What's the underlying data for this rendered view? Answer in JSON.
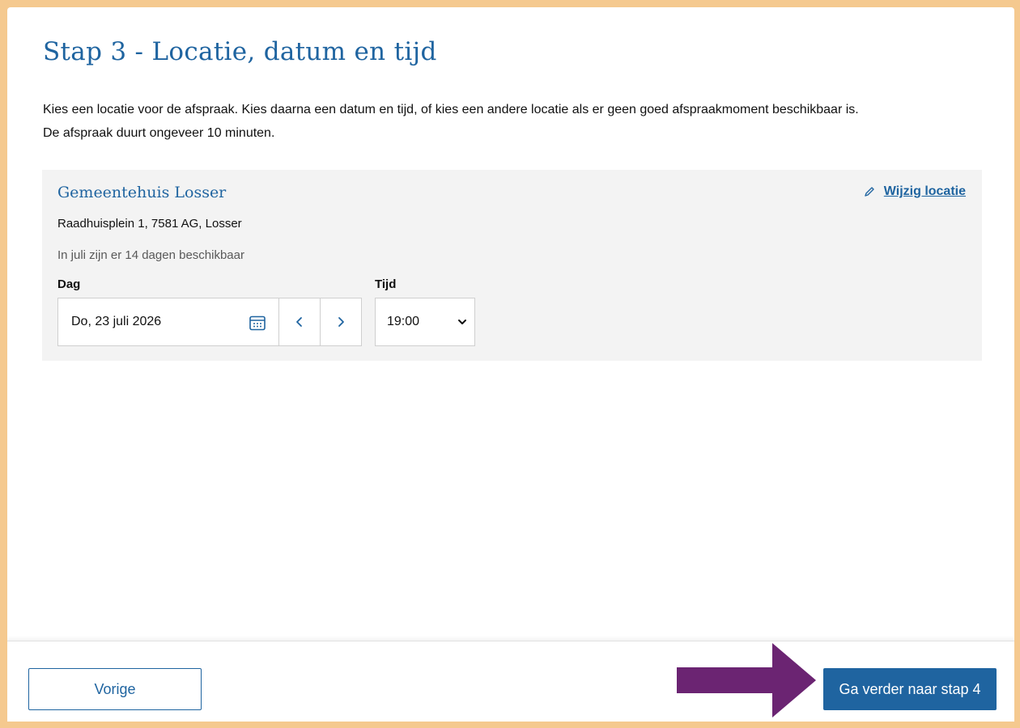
{
  "step": {
    "title": "Stap 3 - Locatie, datum en tijd",
    "intro_line1": "Kies een locatie voor de afspraak. Kies daarna een datum en tijd, of kies een andere locatie als er geen goed afspraakmoment beschikbaar is.",
    "intro_line2": "De afspraak duurt ongeveer 10 minuten."
  },
  "location": {
    "name": "Gemeentehuis Losser",
    "change_label": "Wijzig locatie",
    "address": "Raadhuisplein 1, 7581 AG, Losser",
    "availability": "In juli zijn er 14 dagen beschikbaar"
  },
  "day": {
    "label": "Dag",
    "value": "Do, 23 juli 2026"
  },
  "time": {
    "label": "Tijd",
    "value": "19:00"
  },
  "footer": {
    "prev_label": "Vorige",
    "next_label": "Ga verder naar stap 4"
  },
  "colors": {
    "accent": "#1f64a0",
    "frame": "#f5c98f",
    "arrow": "#6b2472"
  },
  "icons": {
    "edit": "pencil-icon",
    "calendar": "calendar-icon",
    "prev": "chevron-left-icon",
    "next": "chevron-right-icon",
    "select": "chevron-down-icon",
    "annotation": "arrow-right-icon"
  }
}
